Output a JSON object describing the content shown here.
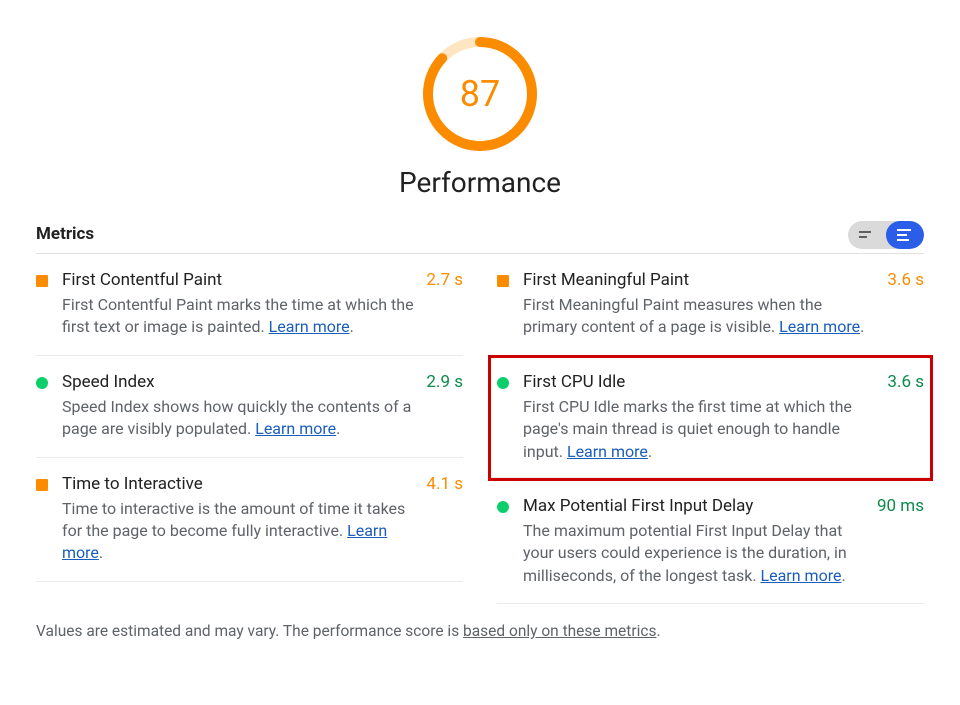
{
  "gauge": {
    "score": "87",
    "label": "Performance",
    "percent": 87,
    "color_arc": "#fb8c00",
    "color_bg": "#ffe6c2"
  },
  "metrics_heading": "Metrics",
  "learn_more": "Learn more",
  "metrics_left": [
    {
      "status": "orange",
      "title": "First Contentful Paint",
      "desc": "First Contentful Paint marks the time at which the first text or image is painted.",
      "value": "2.7 s",
      "value_color": "orange"
    },
    {
      "status": "green",
      "title": "Speed Index",
      "desc": "Speed Index shows how quickly the contents of a page are visibly populated.",
      "value": "2.9 s",
      "value_color": "green"
    },
    {
      "status": "orange",
      "title": "Time to Interactive",
      "desc": "Time to interactive is the amount of time it takes for the page to become fully interactive.",
      "value": "4.1 s",
      "value_color": "orange"
    }
  ],
  "metrics_right": [
    {
      "status": "orange",
      "title": "First Meaningful Paint",
      "desc": "First Meaningful Paint measures when the primary content of a page is visible.",
      "value": "3.6 s",
      "value_color": "orange"
    },
    {
      "status": "green",
      "title": "First CPU Idle",
      "desc": "First CPU Idle marks the first time at which the page's main thread is quiet enough to handle input.",
      "value": "3.6 s",
      "value_color": "green",
      "highlighted": true
    },
    {
      "status": "green",
      "title": "Max Potential First Input Delay",
      "desc": "The maximum potential First Input Delay that your users could experience is the duration, in milliseconds, of the longest task.",
      "value": "90 ms",
      "value_color": "green"
    }
  ],
  "footnote": {
    "prefix": "Values are estimated and may vary. The performance score is ",
    "link": "based only on these metrics",
    "suffix": "."
  }
}
